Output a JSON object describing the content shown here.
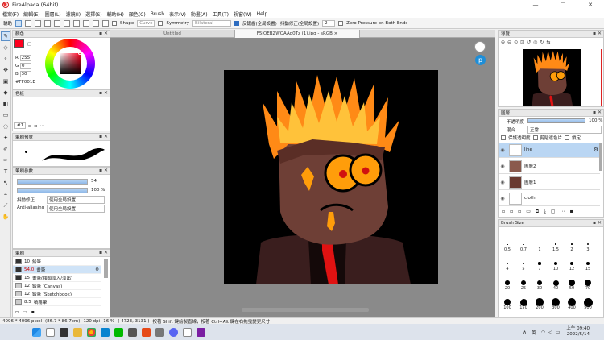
{
  "window": {
    "title": "FireAlpaca (64bit)",
    "minimize": "—",
    "maximize": "☐",
    "close": "✕"
  },
  "menu": [
    "檔案(F)",
    "編輯(E)",
    "圖層(L)",
    "濾鏡(I)",
    "選擇(S)",
    "輔助(H)",
    "顏色(C)",
    "Brush",
    "表示(V)",
    "動畫(A)",
    "工具(T)",
    "視窗(W)",
    "Help"
  ],
  "toolbar": {
    "assist_label": "輔助",
    "shape_label": "Shape",
    "shape_value": "Curve",
    "symmetry_label": "Symmetry",
    "symmetry_value": "Bilateral",
    "antialias_label": "反鋸齒(全局設置)",
    "stabilizer_label": "抖動修正(全局設置)",
    "stabilizer_value": "2",
    "zero_pressure_label": "Zero Pressure on Both Ends"
  },
  "color_panel": {
    "title": "顏色",
    "r_label": "R",
    "r_value": "255",
    "g_label": "G",
    "g_value": "0",
    "b_label": "B",
    "b_value": "30",
    "hex": "#FF001E",
    "current_color": "#ff001e"
  },
  "swatch_panel": {
    "title": "色板",
    "index": "#1"
  },
  "brush_preview_panel": {
    "title": "筆刷預覽"
  },
  "brush_params_panel": {
    "title": "筆刷參數",
    "size_value": "54",
    "opacity_value": "100 %",
    "stabilizer_label": "抖動修正",
    "stabilizer_value": "使用全局設置",
    "antialias_label": "Anti-aliasing",
    "antialias_value": "使用全局設置"
  },
  "brush_list_panel": {
    "title": "筆刷",
    "items": [
      {
        "size": "10",
        "name": "鉛筆",
        "swatch": "#333333"
      },
      {
        "size": "54.0",
        "name": "畫筆",
        "swatch": "#333333"
      },
      {
        "size": "15",
        "name": "畫筆(傾頭淡入/淡出)",
        "swatch": "#333333"
      },
      {
        "size": "12",
        "name": "鉛筆 (Canvas)",
        "swatch": "#cccccc"
      },
      {
        "size": "12",
        "name": "鉛筆 (Sketchbook)",
        "swatch": "#cccccc"
      },
      {
        "size": "8.5",
        "name": "噴霧筆",
        "swatch": "#cccccc"
      }
    ]
  },
  "doc_tabs": [
    {
      "label": "Untitled"
    },
    {
      "label": "F5jOEBZWQAAq0Tz (1).jpg - sRGB ×"
    }
  ],
  "navigator_panel": {
    "title": "導覽"
  },
  "layer_panel": {
    "title": "圖層",
    "opacity_label": "不透明度",
    "opacity_value": "100 %",
    "blend_label": "混合",
    "blend_value": "正常",
    "protect_label": "保護透明度",
    "clip_label": "剪貼遮色片",
    "lock_label": "鎖定",
    "layers": [
      {
        "name": "line"
      },
      {
        "name": "圖層2"
      },
      {
        "name": "圖層1"
      },
      {
        "name": "cloth"
      }
    ]
  },
  "brush_size_panel": {
    "title": "Brush Size",
    "sizes": [
      "0.5",
      "0.7",
      "1",
      "1.5",
      "2",
      "3",
      "4",
      "5",
      "7",
      "10",
      "12",
      "15",
      "20",
      "25",
      "30",
      "40",
      "50",
      "70",
      "100",
      "150",
      "200",
      "300",
      "400",
      "500"
    ]
  },
  "status": {
    "size": "4096 * 4096 pixel",
    "mm": "(86.7 * 86.7cm)",
    "dpi": "120 dpi",
    "zoom": "16 %",
    "coords": "( 4723, 3131 )",
    "hint": "按著 Shift 鍵繪製直線，按著 Ctrl+Alt 鍵在右拖曳變更尺寸"
  },
  "taskbar": {
    "lang": "英",
    "time": "上午 09:40",
    "date": "2022/5/14"
  }
}
